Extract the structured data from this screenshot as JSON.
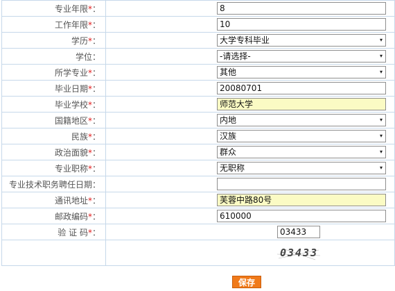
{
  "fields": [
    {
      "label": "专业年限",
      "required": true,
      "type": "text",
      "value": "8",
      "highlight": false
    },
    {
      "label": "工作年限",
      "required": true,
      "type": "text",
      "value": "10",
      "highlight": false
    },
    {
      "label": "学历",
      "required": true,
      "type": "select",
      "value": "大学专科毕业",
      "highlight": false
    },
    {
      "label": "学位",
      "required": false,
      "type": "select",
      "value": "-请选择-",
      "highlight": false
    },
    {
      "label": "所学专业",
      "required": true,
      "type": "select",
      "value": "其他",
      "highlight": false
    },
    {
      "label": "毕业日期",
      "required": true,
      "type": "text",
      "value": "20080701",
      "highlight": false
    },
    {
      "label": "毕业学校",
      "required": true,
      "type": "text",
      "value": "师范大学",
      "highlight": true
    },
    {
      "label": "国籍地区",
      "required": true,
      "type": "select",
      "value": "内地",
      "highlight": false
    },
    {
      "label": "民族",
      "required": true,
      "type": "select",
      "value": "汉族",
      "highlight": false
    },
    {
      "label": "政治面貌",
      "required": true,
      "type": "select",
      "value": "群众",
      "highlight": false
    },
    {
      "label": "专业职称",
      "required": true,
      "type": "select",
      "value": "无职称",
      "highlight": false
    },
    {
      "label": "专业技术职务聘任日期",
      "required": false,
      "type": "text",
      "value": "",
      "highlight": false
    },
    {
      "label": "通讯地址",
      "required": true,
      "type": "text",
      "value": "芙蓉中路80号",
      "highlight": true
    },
    {
      "label": "邮政编码",
      "required": true,
      "type": "text",
      "value": "610000",
      "highlight": false
    }
  ],
  "captcha": {
    "label": "验 证 码",
    "required": true,
    "value": "03433",
    "image_text": "03433"
  },
  "colon": "：",
  "required_mark": "*",
  "dropdown_icon": "▾",
  "save_label": "保存",
  "colors": {
    "border": "#c6d8ea",
    "required": "#e02020",
    "highlight": "#fbfbc4",
    "button": "#f07a1a"
  }
}
